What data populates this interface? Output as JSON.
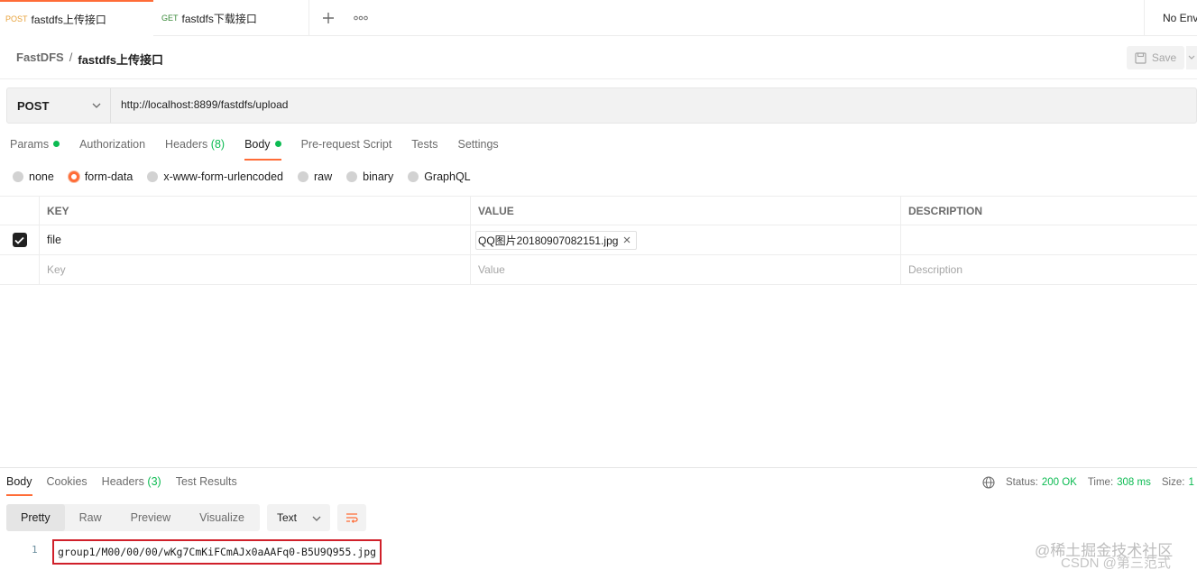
{
  "tabs": [
    {
      "method": "POST",
      "name": "fastdfs上传接口"
    },
    {
      "method": "GET",
      "name": "fastdfs下载接口"
    }
  ],
  "environment": "No Envi",
  "breadcrumb": {
    "collection": "FastDFS",
    "separator": "/",
    "request": "fastdfs上传接口"
  },
  "save_label": "Save",
  "request": {
    "method": "POST",
    "url": "http://localhost:8899/fastdfs/upload"
  },
  "request_tabs": {
    "params": "Params",
    "authorization": "Authorization",
    "headers": "Headers",
    "headers_count": "(8)",
    "body": "Body",
    "prerequest": "Pre-request Script",
    "tests": "Tests",
    "settings": "Settings"
  },
  "body_types": {
    "none": "none",
    "form_data": "form-data",
    "urlencoded": "x-www-form-urlencoded",
    "raw": "raw",
    "binary": "binary",
    "graphql": "GraphQL",
    "selected": "form-data"
  },
  "form_table": {
    "headers": {
      "key": "KEY",
      "value": "VALUE",
      "description": "DESCRIPTION"
    },
    "rows": [
      {
        "checked": true,
        "key": "file",
        "value": "QQ图片20180907082151.jpg",
        "description": ""
      }
    ],
    "placeholders": {
      "key": "Key",
      "value": "Value",
      "description": "Description"
    }
  },
  "response_tabs": {
    "body": "Body",
    "cookies": "Cookies",
    "headers": "Headers",
    "headers_count": "(3)",
    "test_results": "Test Results"
  },
  "response_meta": {
    "status_label": "Status:",
    "status_value": "200 OK",
    "time_label": "Time:",
    "time_value": "308 ms",
    "size_label": "Size:",
    "size_value": "1"
  },
  "view_modes": {
    "pretty": "Pretty",
    "raw": "Raw",
    "preview": "Preview",
    "visualize": "Visualize"
  },
  "format": "Text",
  "response_body": {
    "line_number": "1",
    "text": "group1/M00/00/00/wKg7CmKiFCmAJx0aAAFq0-B5U9Q955.jpg"
  },
  "watermark": {
    "line1": "@稀土掘金技术社区",
    "line2": "CSDN @第三范式"
  },
  "colors": {
    "accent": "#ff6c37",
    "success": "#0cbb52",
    "highlight_border": "#d0202a"
  }
}
